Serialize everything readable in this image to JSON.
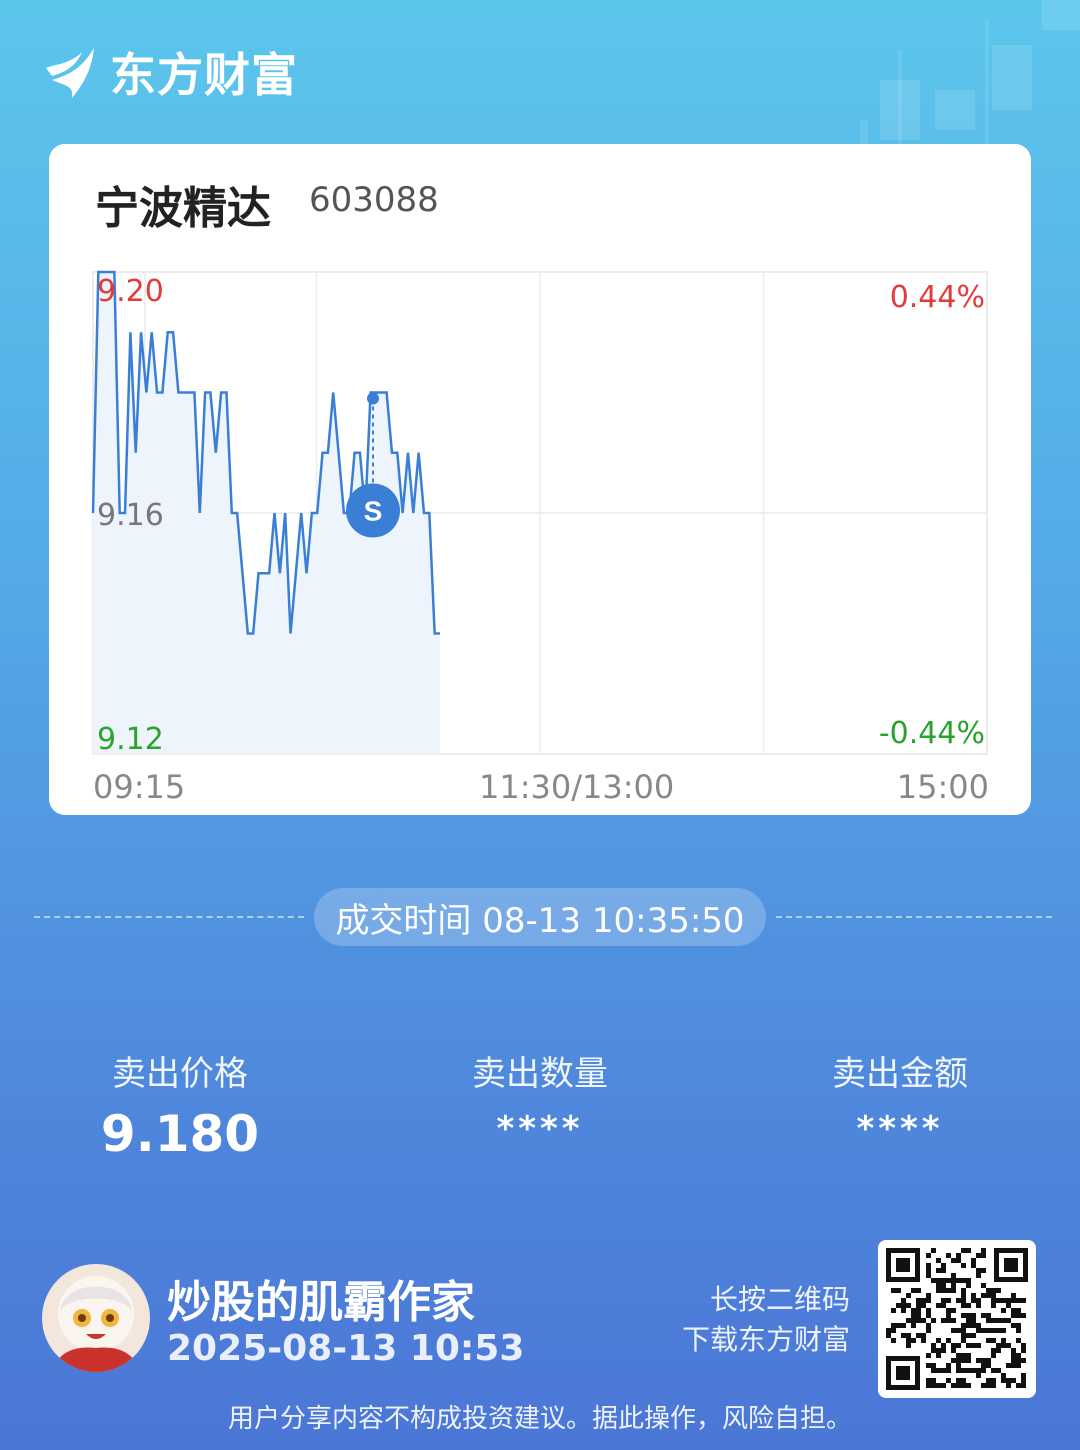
{
  "brand": {
    "name": "东方财富",
    "icon": "eastmoney-logo-icon"
  },
  "stock": {
    "name": "宁波精达",
    "code": "603088"
  },
  "chart_data": {
    "type": "line",
    "title": "",
    "ylabel": "",
    "xlabel": "",
    "y_left_ticks": [
      "9.20",
      "9.16",
      "9.12"
    ],
    "y_right_ticks": [
      "0.44%",
      "-0.44%"
    ],
    "x_ticks": [
      "09:15",
      "11:30/13:00",
      "15:00"
    ],
    "ylim": [
      9.12,
      9.2
    ],
    "grid": true,
    "series": [
      {
        "values": [
          9.16,
          9.2,
          9.2,
          9.2,
          9.2,
          9.16,
          9.16,
          9.19,
          9.17,
          9.19,
          9.18,
          9.19,
          9.18,
          9.18,
          9.19,
          9.19,
          9.18,
          9.18,
          9.18,
          9.18,
          9.16,
          9.18,
          9.18,
          9.17,
          9.18,
          9.18,
          9.16,
          9.16,
          9.15,
          9.14,
          9.14,
          9.15,
          9.15,
          9.15,
          9.16,
          9.15,
          9.16,
          9.14,
          9.15,
          9.16,
          9.15,
          9.16,
          9.16,
          9.17,
          9.17,
          9.18,
          9.17,
          9.16,
          9.16,
          9.17,
          9.17,
          9.16,
          9.18,
          9.18,
          9.18,
          9.18,
          9.17,
          9.17,
          9.16,
          9.17,
          9.16,
          9.17,
          9.16,
          9.16,
          9.14,
          9.14
        ]
      }
    ],
    "trade_marker": {
      "label": "S",
      "price": 9.18,
      "time": "10:35:50"
    }
  },
  "trade": {
    "time_label": "成交时间 08-13 10:35:50",
    "stats": [
      {
        "label": "卖出价格",
        "value": "9.180"
      },
      {
        "label": "卖出数量",
        "value": "****"
      },
      {
        "label": "卖出金额",
        "value": "****"
      }
    ]
  },
  "user": {
    "name": "炒股的肌霸作家",
    "time": "2025-08-13 10:53"
  },
  "qr": {
    "hint_line1": "长按二维码",
    "hint_line2": "下载东方财富"
  },
  "disclaimer": "用户分享内容不构成投资建议。据此操作，风险自担。",
  "colors": {
    "up": "#e23b3b",
    "down": "#2aa32a",
    "line": "#3a7fd5",
    "marker": "#3a7fd5"
  }
}
